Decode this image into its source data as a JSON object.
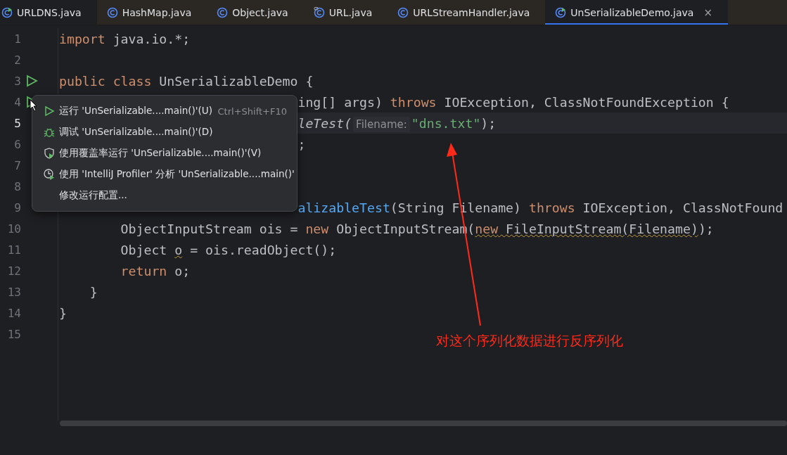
{
  "tabs": [
    {
      "label": "URLDNS.java",
      "kind": "run-class",
      "selected": false,
      "closable": false
    },
    {
      "label": "HashMap.java",
      "kind": "class",
      "selected": false,
      "closable": false
    },
    {
      "label": "Object.java",
      "kind": "class",
      "selected": false,
      "closable": false
    },
    {
      "label": "URL.java",
      "kind": "lib-class",
      "selected": false,
      "closable": false
    },
    {
      "label": "URLStreamHandler.java",
      "kind": "class",
      "selected": false,
      "closable": false
    },
    {
      "label": "UnSerializableDemo.java",
      "kind": "run-class",
      "selected": true,
      "closable": true,
      "close": "×"
    }
  ],
  "editor": {
    "lines": [
      {
        "number": "1",
        "current": false,
        "run_icon": false,
        "partly_hidden": false,
        "tokens": [
          {
            "kind": "keyword",
            "text": "import"
          },
          {
            "kind": "plain",
            "text": " java.io.*;"
          }
        ]
      },
      {
        "number": "2",
        "current": false,
        "run_icon": false,
        "partly_hidden": false
      },
      {
        "number": "3",
        "current": false,
        "run_icon": true,
        "partly_hidden": false,
        "tokens": [
          {
            "kind": "keyword",
            "text": "public class"
          },
          {
            "kind": "plain",
            "text": " UnSerializableDemo {"
          }
        ]
      },
      {
        "number": "4",
        "current": false,
        "run_icon": true,
        "partly_hidden": true,
        "tokens": [
          {
            "kind": "plain",
            "text": "ing[] args) "
          },
          {
            "kind": "keyword",
            "text": "throws"
          },
          {
            "kind": "plain",
            "text": " IOException, ClassNotFoundException {"
          }
        ]
      },
      {
        "number": "5",
        "current": true,
        "run_icon": false,
        "partly_hidden": true,
        "tokens": [
          {
            "kind": "static-call",
            "text": "leTest("
          },
          {
            "kind": "hint",
            "text": "Filename:"
          },
          {
            "kind": "string",
            "text": "\"dns.txt\""
          },
          {
            "kind": "plain",
            "text": ");"
          }
        ]
      },
      {
        "number": "6",
        "current": false,
        "run_icon": false,
        "partly_hidden": true,
        "tokens": [
          {
            "kind": "plain",
            "text": ";"
          }
        ]
      },
      {
        "number": "7",
        "current": false,
        "run_icon": false,
        "partly_hidden": false
      },
      {
        "number": "8",
        "current": false,
        "run_icon": false,
        "partly_hidden": false
      },
      {
        "number": "9",
        "current": false,
        "run_icon": false,
        "partly_hidden": true,
        "tokens": [
          {
            "kind": "method",
            "text": "alizableTest"
          },
          {
            "kind": "plain",
            "text": "(String Filename) "
          },
          {
            "kind": "keyword",
            "text": "throws"
          },
          {
            "kind": "plain",
            "text": " IOException, ClassNotFound"
          }
        ]
      },
      {
        "number": "10",
        "current": false,
        "run_icon": false,
        "partly_hidden": false,
        "tokens": [
          {
            "kind": "plain",
            "text": "        ObjectInputStream ois = "
          },
          {
            "kind": "keyword",
            "text": "new"
          },
          {
            "kind": "plain",
            "text": " ObjectInputStream("
          },
          {
            "kind": "keyword",
            "text": "new",
            "warn": true
          },
          {
            "kind": "plain",
            "text": " FileInputStream(Filename)",
            "warn": true
          },
          {
            "kind": "plain",
            "text": ");"
          }
        ]
      },
      {
        "number": "11",
        "current": false,
        "run_icon": false,
        "partly_hidden": false,
        "tokens": [
          {
            "kind": "plain",
            "text": "        Object "
          },
          {
            "kind": "plain",
            "text": "o",
            "warn": true
          },
          {
            "kind": "plain",
            "text": " = ois.readObject();"
          }
        ]
      },
      {
        "number": "12",
        "current": false,
        "run_icon": false,
        "partly_hidden": false,
        "tokens": [
          {
            "kind": "keyword",
            "text": "        return"
          },
          {
            "kind": "plain",
            "text": " o;"
          }
        ]
      },
      {
        "number": "13",
        "current": false,
        "run_icon": false,
        "partly_hidden": false,
        "tokens": [
          {
            "kind": "plain",
            "text": "    }"
          }
        ]
      },
      {
        "number": "14",
        "current": false,
        "run_icon": false,
        "partly_hidden": false,
        "tokens": [
          {
            "kind": "plain",
            "text": "}"
          }
        ]
      },
      {
        "number": "15",
        "current": false,
        "run_icon": false,
        "partly_hidden": false
      }
    ]
  },
  "context_menu": {
    "items": [
      {
        "kind": "run",
        "label": "运行 'UnSerializable....main()'(U)",
        "shortcut": "Ctrl+Shift+F10"
      },
      {
        "kind": "debug",
        "label": "调试 'UnSerializable....main()'(D)"
      },
      {
        "kind": "coverage",
        "label": "使用覆盖率运行 'UnSerializable....main()'(V)"
      },
      {
        "kind": "profiler",
        "label": "使用 'IntelliJ Profiler' 分析  'UnSerializable....main()'"
      },
      {
        "kind": "none",
        "label": "修改运行配置..."
      }
    ]
  },
  "annotation": {
    "text": "对这个序列化数据进行反序列化"
  }
}
